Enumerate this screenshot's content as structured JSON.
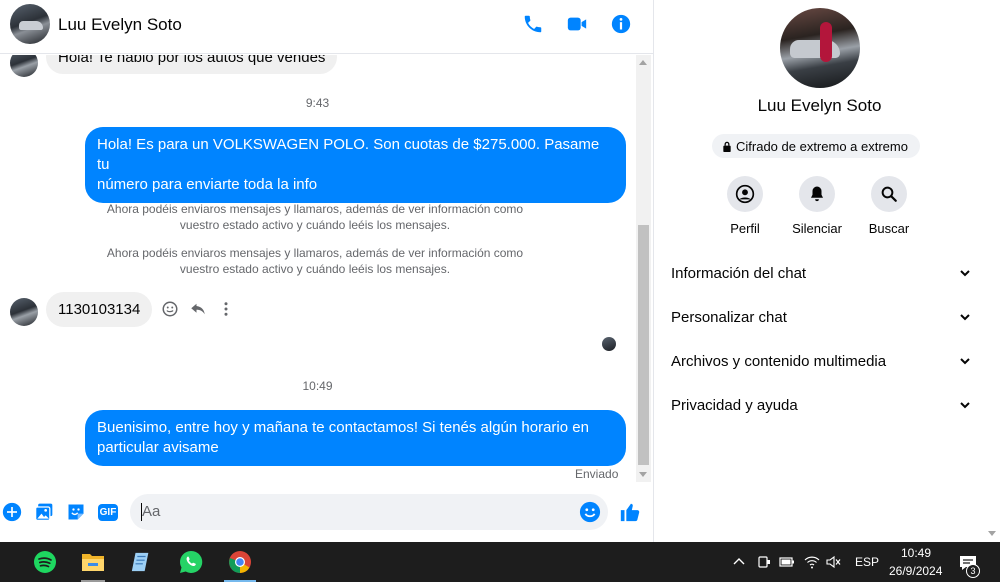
{
  "header": {
    "contact_name": "Luu Evelyn Soto",
    "icons": [
      "phone-icon",
      "video-camera-icon",
      "info-icon"
    ]
  },
  "chat": {
    "messages": [
      {
        "type": "incoming",
        "text": "Hola! Te hablo por los autos que vendes"
      },
      {
        "type": "time",
        "text": "9:43"
      },
      {
        "type": "outgoing",
        "lines": [
          "Hola! Es para un VOLKSWAGEN POLO. Son cuotas de $275.000. Pasame tu",
          "número para enviarte toda la info"
        ]
      },
      {
        "type": "system",
        "lines": [
          "Ahora podéis enviaros mensajes y llamaros, además de ver información como",
          "vuestro estado activo y cuándo leéis los mensajes."
        ]
      },
      {
        "type": "system",
        "lines": [
          "Ahora podéis enviaros mensajes y llamaros, además de ver información como",
          "vuestro estado activo y cuándo leéis los mensajes."
        ]
      },
      {
        "type": "incoming",
        "text": "1130103134"
      },
      {
        "type": "time",
        "text": "10:49"
      },
      {
        "type": "outgoing",
        "lines": [
          "Buenisimo, entre hoy y mañana te contactamos! Si tenés algún horario en",
          "particular avisame"
        ]
      }
    ],
    "status": "Enviado"
  },
  "composer": {
    "placeholder": "Aa",
    "gif_label": "GIF",
    "icons": [
      "plus-icon",
      "image-icon",
      "sticker-icon",
      "gif-icon",
      "emoji-icon",
      "thumbs-up-icon"
    ]
  },
  "info_panel": {
    "name": "Luu Evelyn Soto",
    "encryption_label": "Cifrado de extremo a extremo",
    "actions": [
      {
        "label": "Perfil",
        "icon": "profile-icon"
      },
      {
        "label": "Silenciar",
        "icon": "bell-icon"
      },
      {
        "label": "Buscar",
        "icon": "search-icon"
      }
    ],
    "sections": [
      "Información del chat",
      "Personalizar chat",
      "Archivos y contenido multimedia",
      "Privacidad y ayuda"
    ]
  },
  "taskbar": {
    "apps": [
      "spotify-icon",
      "file-explorer-icon",
      "notes-icon",
      "whatsapp-icon",
      "chrome-icon"
    ],
    "language": "ESP",
    "time": "10:49",
    "date": "26/9/2024",
    "notification_count": "3"
  },
  "colors": {
    "accent": "#0084ff",
    "incoming_bubble": "#f0f0f0",
    "taskbar": "#1d1d1d"
  }
}
